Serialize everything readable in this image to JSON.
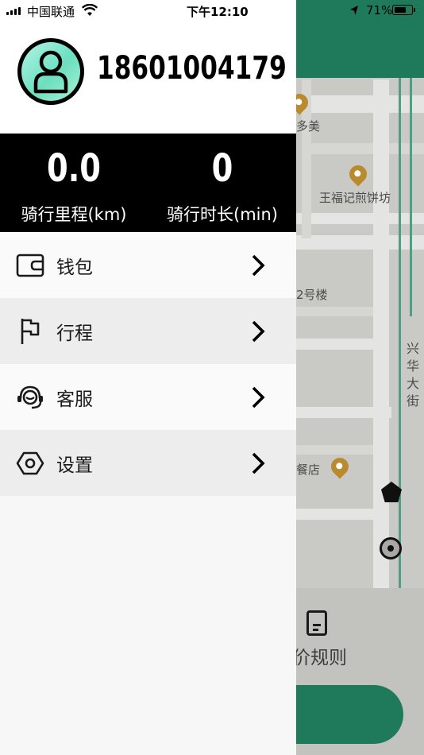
{
  "status_bar": {
    "carrier": "中国联通",
    "time": "下午12:10",
    "battery_percent": "71%",
    "battery_level": 0.71
  },
  "profile": {
    "phone": "18601004179"
  },
  "stats": {
    "distance_value": "0.0",
    "distance_label": "骑行里程(km)",
    "duration_value": "0",
    "duration_label": "骑行时长(min)"
  },
  "menu": {
    "items": [
      {
        "label": "钱包",
        "icon": "wallet-icon"
      },
      {
        "label": "行程",
        "icon": "flag-icon"
      },
      {
        "label": "客服",
        "icon": "headset-icon"
      },
      {
        "label": "设置",
        "icon": "hexagon-settings-icon"
      }
    ]
  },
  "map": {
    "labels": [
      "多美",
      "王福记煎饼坊",
      "2号楼",
      "兴华大街",
      "餐店"
    ],
    "rule_text": "价规则"
  },
  "colors": {
    "accent": "#1f7a5c",
    "avatar_gradient": "#6cdfbf",
    "stats_bg": "#000000"
  }
}
